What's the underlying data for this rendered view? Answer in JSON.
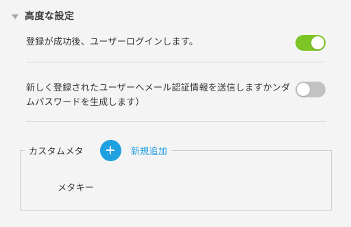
{
  "section": {
    "title": "高度な設定",
    "caret_icon": "caret-down-icon"
  },
  "settings": [
    {
      "label": "登録が成功後、ユーザーログインします。",
      "enabled": true
    },
    {
      "label": "新しく登録されたユーザーへメール認証情報を送信しますかンダムパスワードを生成します）",
      "enabled": false
    }
  ],
  "custom_meta": {
    "legend": "カスタムメタ",
    "add_icon": "plus-icon",
    "add_label": "新規追加",
    "key_label": "メタキー"
  },
  "colors": {
    "toggle_on": "#7cc524",
    "toggle_off": "#c2c2c2",
    "accent": "#1fa0e0",
    "link": "#1c9be0"
  }
}
